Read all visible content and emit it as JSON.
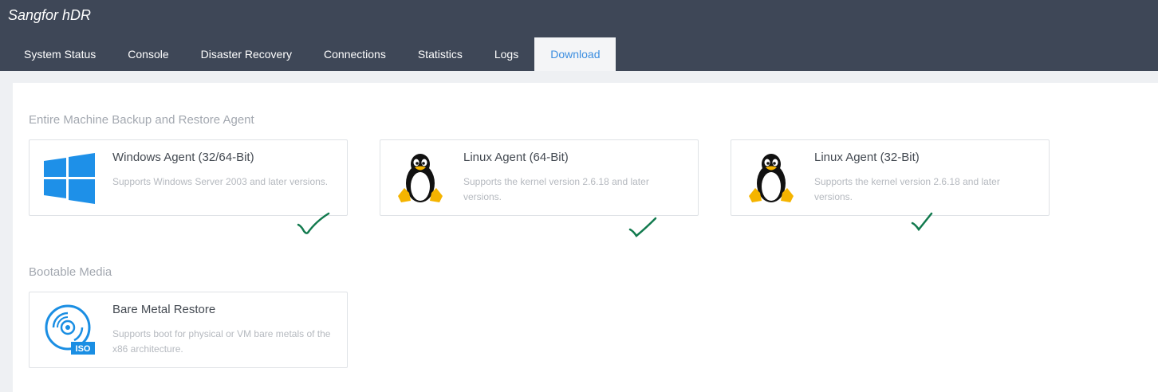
{
  "app": {
    "brand": "Sangfor hDR"
  },
  "nav": {
    "tabs": [
      {
        "label": "System Status",
        "active": false
      },
      {
        "label": "Console",
        "active": false
      },
      {
        "label": "Disaster Recovery",
        "active": false
      },
      {
        "label": "Connections",
        "active": false
      },
      {
        "label": "Statistics",
        "active": false
      },
      {
        "label": "Logs",
        "active": false
      },
      {
        "label": "Download",
        "active": true
      }
    ]
  },
  "sections": {
    "agents": {
      "title": "Entire Machine Backup and Restore Agent",
      "cards": [
        {
          "icon": "windows-icon",
          "title": "Windows Agent (32/64-Bit)",
          "description": "Supports Windows Server 2003 and later versions."
        },
        {
          "icon": "linux-tux-icon",
          "title": "Linux Agent (64-Bit)",
          "description": "Supports the kernel version 2.6.18 and later versions."
        },
        {
          "icon": "linux-tux-icon",
          "title": "Linux Agent (32-Bit)",
          "description": "Supports the kernel version 2.6.18 and later versions."
        }
      ]
    },
    "media": {
      "title": "Bootable Media",
      "cards": [
        {
          "icon": "iso-disc-icon",
          "title": "Bare Metal Restore",
          "description": "Supports boot for physical or VM bare metals of the x86 architecture.",
          "badge": "ISO"
        }
      ]
    }
  },
  "colors": {
    "header_bg": "#3e4757",
    "active_tab_text": "#3c8ee0",
    "windows_blue": "#1e90e8",
    "iso_blue": "#1a8ee3",
    "checkmark_green": "#127a4e"
  }
}
